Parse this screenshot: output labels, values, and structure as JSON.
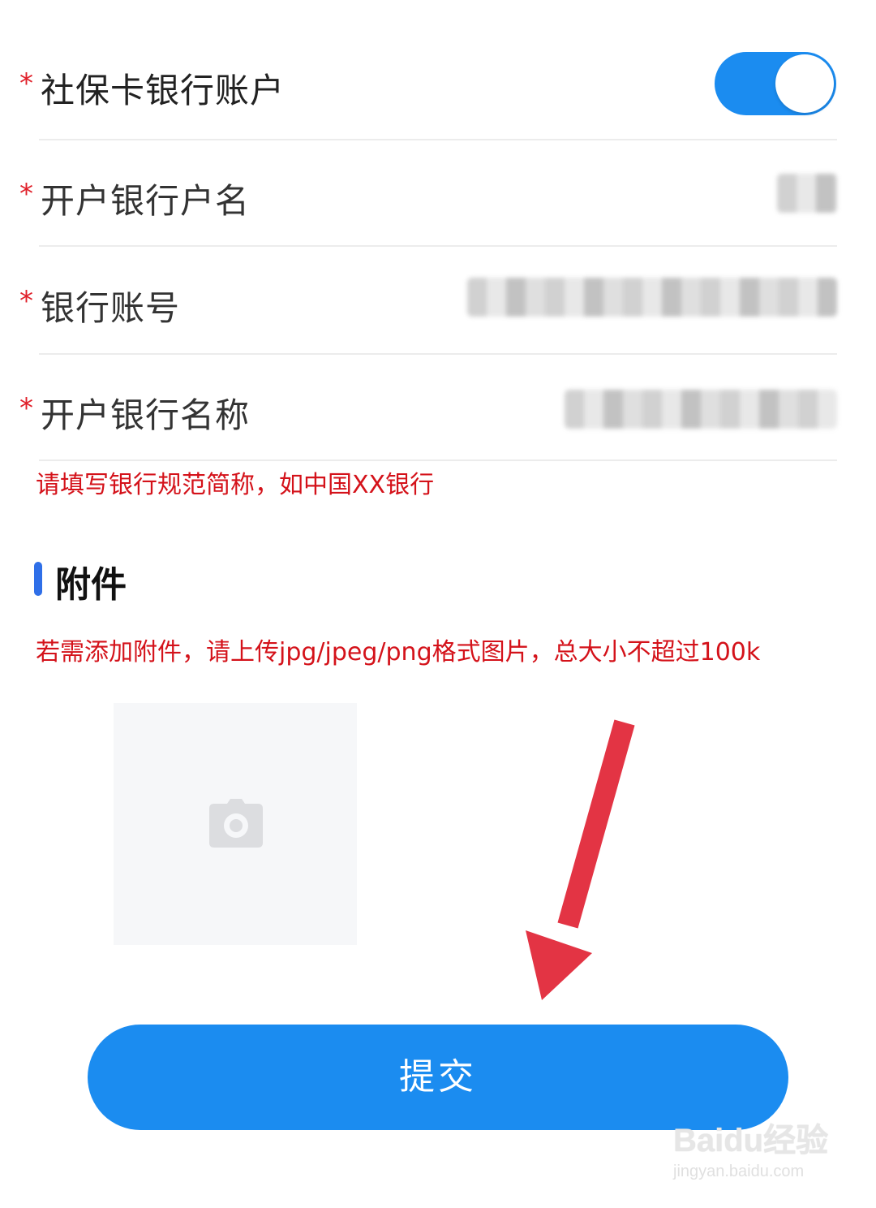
{
  "form": {
    "required_mark": "*",
    "fields": [
      {
        "label": "社保卡银行账户"
      },
      {
        "label": "开户银行户名"
      },
      {
        "label": "银行账号"
      },
      {
        "label": "开户银行名称"
      }
    ],
    "toggle_on": true,
    "bank_name_hint": "请填写银行规范简称，如中国XX银行"
  },
  "attachments": {
    "title": "附件",
    "hint": "若需添加附件，请上传jpg/jpeg/png格式图片，总大小不超过100k",
    "upload_icon": "camera-icon"
  },
  "actions": {
    "submit_label": "提交"
  },
  "annotation": {
    "arrow_color": "#e33444"
  },
  "watermark": {
    "brand": "Baidu经验",
    "url": "jingyan.baidu.com"
  },
  "colors": {
    "accent": "#1b8cf0",
    "required": "#e0202a",
    "hint": "#d4121a",
    "section_bar": "#2f6fe8"
  }
}
